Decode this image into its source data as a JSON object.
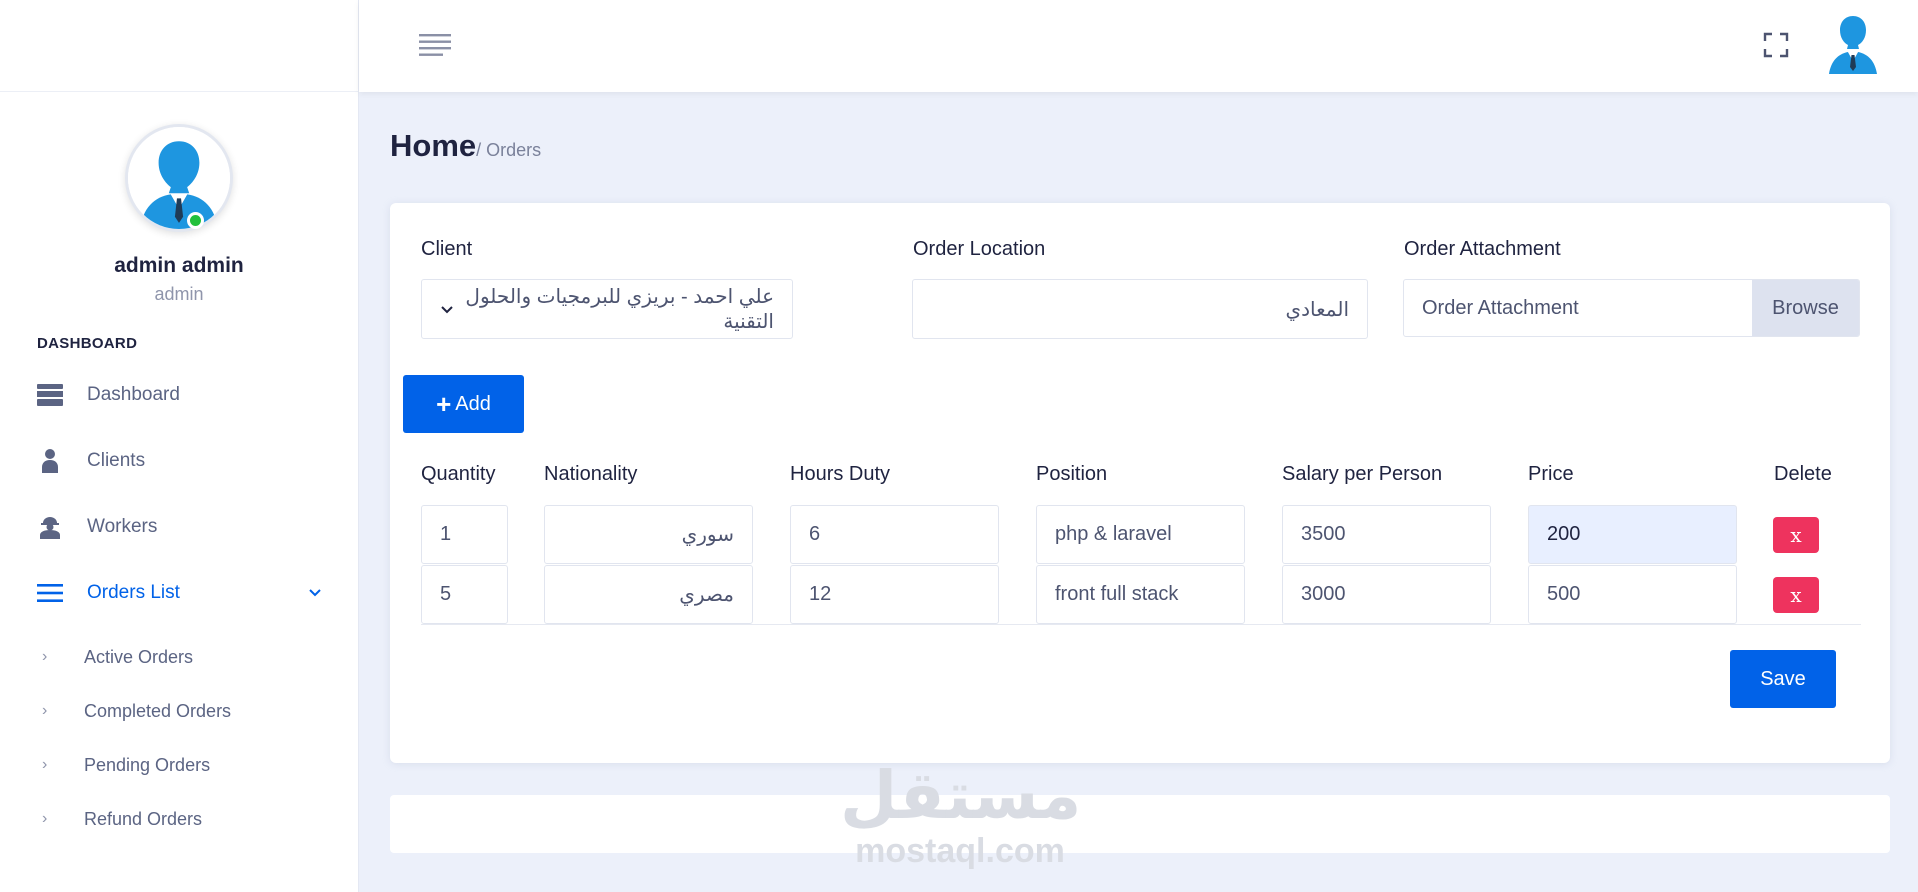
{
  "sidebar": {
    "profile": {
      "name": "admin admin",
      "role": "admin"
    },
    "section_title": "DASHBOARD",
    "items": [
      {
        "label": "Dashboard",
        "icon": "dashboard-icon"
      },
      {
        "label": "Clients",
        "icon": "user-icon"
      },
      {
        "label": "Workers",
        "icon": "worker-icon"
      },
      {
        "label": "Orders List",
        "icon": "list-icon"
      }
    ],
    "sub_items": [
      {
        "label": "Active Orders"
      },
      {
        "label": "Completed Orders"
      },
      {
        "label": "Pending Orders"
      },
      {
        "label": "Refund Orders"
      }
    ],
    "arrow": "›"
  },
  "header": {
    "menu_icon": "hamburger-icon",
    "fullscreen_icon": "fullscreen-icon",
    "avatar_icon": "user-avatar-icon"
  },
  "breadcrumb": {
    "home": "Home",
    "current": "/ Orders"
  },
  "form": {
    "client_label": "Client",
    "client_value": "علي احمد - بريزي للبرمجيات والحلول التقنية",
    "location_label": "Order Location",
    "location_value": "المعادي",
    "attachment_label": "Order Attachment",
    "attachment_placeholder": "Order Attachment",
    "browse_label": "Browse",
    "add_label": "Add",
    "save_label": "Save"
  },
  "table": {
    "headers": [
      "Quantity",
      "Nationality",
      "Hours Duty",
      "Position",
      "Salary per Person",
      "Price",
      "Delete"
    ],
    "rows": [
      {
        "quantity": "1",
        "nationality": "سوري",
        "hours": "6",
        "position": "php & laravel",
        "salary": "3500",
        "price": "200"
      },
      {
        "quantity": "5",
        "nationality": "مصري",
        "hours": "12",
        "position": "front full stack",
        "salary": "3000",
        "price": "500"
      }
    ],
    "delete_label": "x"
  },
  "watermark": {
    "arabic": "مستقل",
    "latin": "mostaql.com"
  },
  "colors": {
    "primary": "#0162e8",
    "danger": "#ee335e",
    "online": "#22c03c",
    "background": "#ecf0fa"
  }
}
